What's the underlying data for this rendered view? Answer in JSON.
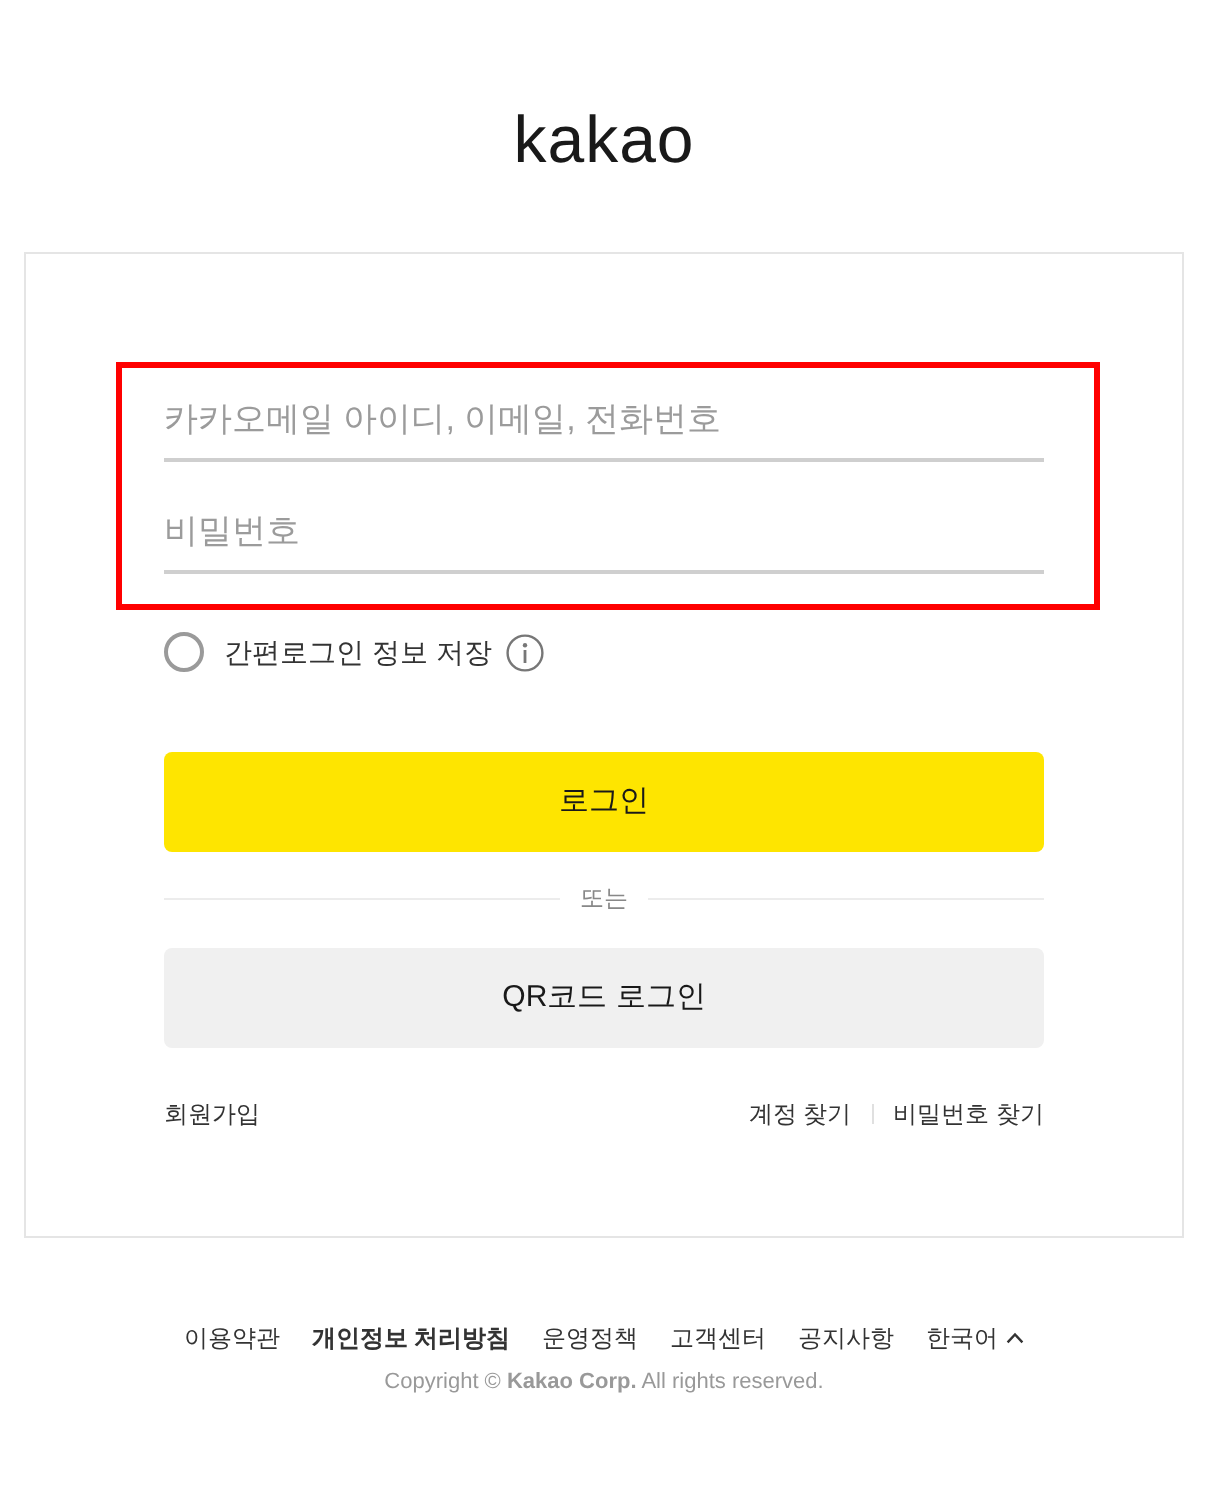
{
  "logo": "kakao",
  "form": {
    "fields": [
      {
        "placeholder": "카카오메일 아이디, 이메일, 전화번호"
      },
      {
        "placeholder": "비밀번호"
      }
    ],
    "remember": {
      "label": "간편로그인 정보 저장",
      "checked": false
    },
    "login_button": "로그인",
    "divider": "또는",
    "qr_button": "QR코드 로그인",
    "signup": "회원가입",
    "find_links": [
      "계정 찾기",
      "비밀번호 찾기"
    ]
  },
  "footer": {
    "links": [
      {
        "label": "이용약관",
        "bold": false
      },
      {
        "label": "개인정보 처리방침",
        "bold": true
      },
      {
        "label": "운영정책",
        "bold": false
      },
      {
        "label": "고객센터",
        "bold": false
      },
      {
        "label": "공지사항",
        "bold": false
      }
    ],
    "language": "한국어",
    "copyright": "Copyright © **Kakao Corp.** All rights reserved."
  }
}
